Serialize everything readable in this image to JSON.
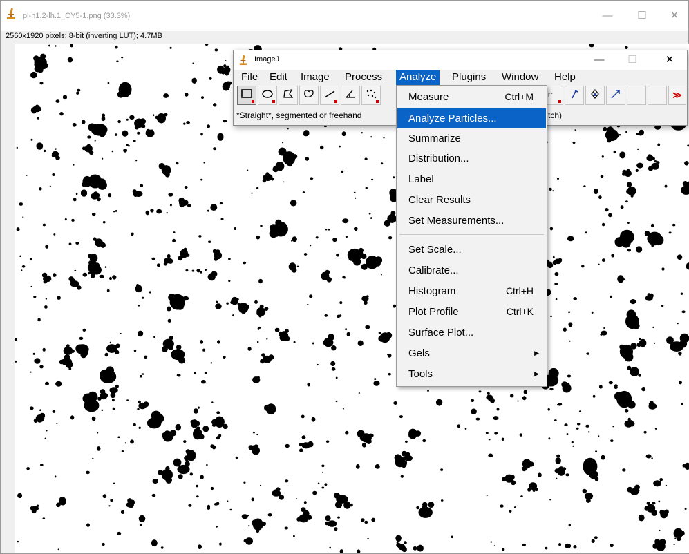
{
  "image_window": {
    "title": "pl-h1.2-lh.1_CY5-1.png (33.3%)",
    "info": "2560x1920 pixels; 8-bit (inverting LUT); 4.7MB",
    "controls": {
      "minimize": "—",
      "maximize": "☐",
      "close": "✕"
    }
  },
  "imagej_window": {
    "title": "ImageJ",
    "controls": {
      "minimize": "—",
      "maximize": "☐",
      "close": "✕"
    },
    "menubar": [
      {
        "label": "File"
      },
      {
        "label": "Edit"
      },
      {
        "label": "Image"
      },
      {
        "label": "Process"
      },
      {
        "label": "Analyze",
        "active": true
      },
      {
        "label": "Plugins"
      },
      {
        "label": "Window"
      },
      {
        "label": "Help"
      }
    ],
    "status_left": "*Straight*, segmented or freehand",
    "status_right": "tch)",
    "more_tools": "≫"
  },
  "analyze_menu": {
    "items": [
      {
        "label": "Measure",
        "shortcut": "Ctrl+M"
      },
      {
        "label": "Analyze Particles...",
        "highlighted": true
      },
      {
        "label": "Summarize"
      },
      {
        "label": "Distribution..."
      },
      {
        "label": "Label"
      },
      {
        "label": "Clear Results"
      },
      {
        "label": "Set Measurements..."
      },
      {
        "label": "Set Scale..."
      },
      {
        "label": "Calibrate..."
      },
      {
        "label": "Histogram",
        "shortcut": "Ctrl+H"
      },
      {
        "label": "Plot Profile",
        "shortcut": "Ctrl+K"
      },
      {
        "label": "Surface Plot..."
      },
      {
        "label": "Gels",
        "submenu": true
      },
      {
        "label": "Tools",
        "submenu": true
      }
    ]
  },
  "colors": {
    "menu_highlight": "#0a64c8",
    "window_bg": "#f0f0f0",
    "particle": "#000000",
    "tool_marker": "#d10000"
  },
  "icons": [
    "imagej-microscope-icon",
    "rectangle-tool-icon",
    "oval-tool-icon",
    "polygon-tool-icon",
    "freehand-tool-icon",
    "line-tool-icon",
    "angle-tool-icon",
    "multipoint-tool-icon",
    "color-picker-icon",
    "brush-icon",
    "dropper-icon",
    "arrow-icon",
    "more-tools-icon",
    "submenu-arrow-icon"
  ]
}
